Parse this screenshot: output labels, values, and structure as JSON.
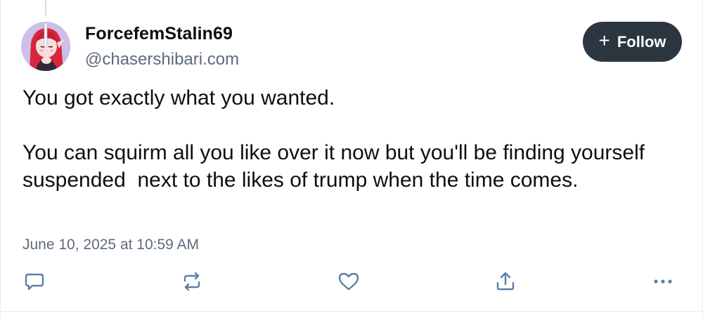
{
  "post": {
    "author": {
      "display_name": "ForcefemStalin69",
      "handle": "@chasershibari.com",
      "avatar": "anime-character-avatar"
    },
    "follow_button": {
      "icon": "plus-icon",
      "label": "Follow"
    },
    "text": "You got exactly what you wanted.\n\nYou can squirm all you like over it now but you'll be finding yourself suspended  next to the likes of trump when the time comes.",
    "timestamp": "June 10, 2025 at 10:59 AM",
    "actions": [
      {
        "name": "reply",
        "icon": "speech-bubble-icon"
      },
      {
        "name": "repost",
        "icon": "repost-arrows-icon"
      },
      {
        "name": "like",
        "icon": "heart-icon"
      },
      {
        "name": "share",
        "icon": "share-upload-icon"
      },
      {
        "name": "more",
        "icon": "ellipsis-icon"
      }
    ]
  },
  "colors": {
    "follow_button_bg": "#2b3641",
    "muted_text": "#5f6b7a",
    "icon_color": "#5b7faa",
    "text": "#0b0f14"
  }
}
